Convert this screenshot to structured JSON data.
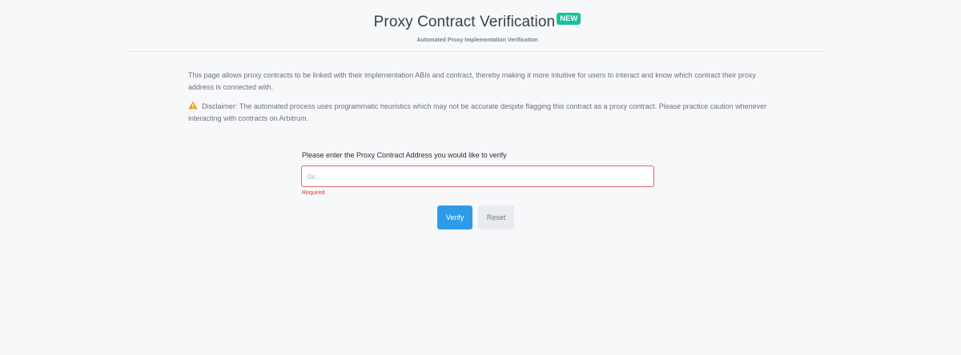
{
  "header": {
    "title": "Proxy Contract Verification",
    "badge": "NEW",
    "subtitle": "Automated Proxy Implementation Verification"
  },
  "intro_text": "This page allows proxy contracts to be linked with their implementation ABIs and contract, thereby making it more intuitive for users to interact and know which contract their proxy address is connected with.",
  "disclaimer": {
    "icon": "warning-icon",
    "text": "Disclaimer: The automated process uses programmatic heuristics which may not be accurate despite flagging this contract as a proxy contract. Please practice caution whenever interacting with contracts on Arbitrum."
  },
  "form": {
    "label": "Please enter the Proxy Contract Address you would like to verify",
    "input_value": "",
    "placeholder": "0x...",
    "error": "Required",
    "verify_label": "Verify",
    "reset_label": "Reset"
  },
  "colors": {
    "badge": "#16c29b",
    "primary": "#2f9be8",
    "error": "#d9363e",
    "warning": "#e8a317"
  }
}
